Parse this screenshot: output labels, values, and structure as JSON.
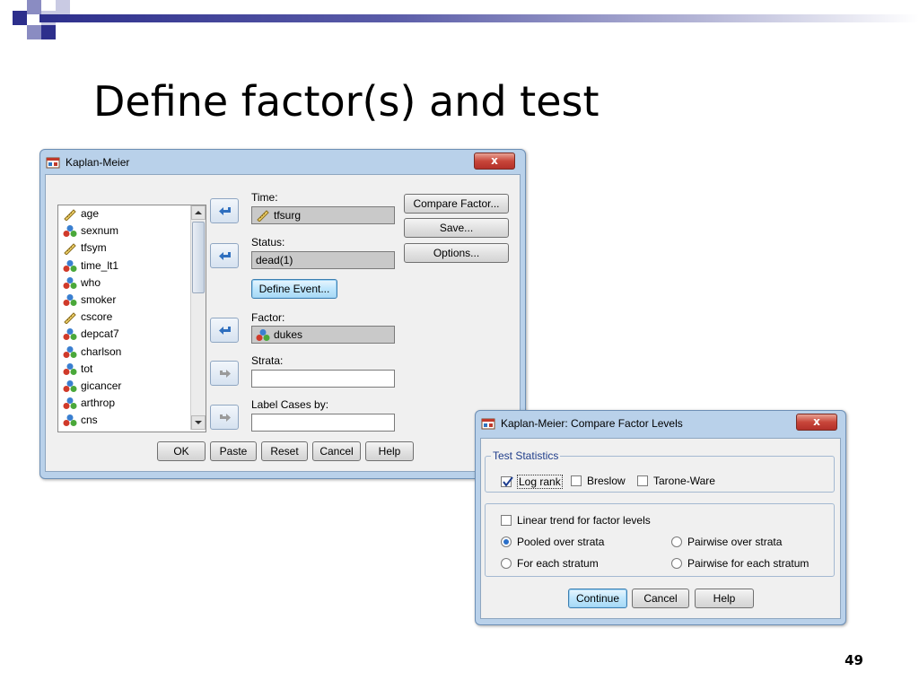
{
  "slide": {
    "title": "Define factor(s) and test",
    "page_number": "49"
  },
  "km_dialog": {
    "title": "Kaplan-Meier",
    "close_label": "x",
    "variables": [
      {
        "name": "age",
        "icon": "scale-ruler-icon"
      },
      {
        "name": "sexnum",
        "icon": "nominal-balls-icon"
      },
      {
        "name": "tfsym",
        "icon": "scale-ruler-icon"
      },
      {
        "name": "time_lt1",
        "icon": "nominal-balls-icon"
      },
      {
        "name": "who",
        "icon": "nominal-balls-icon"
      },
      {
        "name": "smoker",
        "icon": "nominal-balls-icon"
      },
      {
        "name": "cscore",
        "icon": "scale-ruler-icon"
      },
      {
        "name": "depcat7",
        "icon": "nominal-balls-icon"
      },
      {
        "name": "charlson",
        "icon": "nominal-balls-icon"
      },
      {
        "name": "tot",
        "icon": "nominal-balls-icon"
      },
      {
        "name": "gicancer",
        "icon": "nominal-balls-icon"
      },
      {
        "name": "arthrop",
        "icon": "nominal-balls-icon"
      },
      {
        "name": "cns",
        "icon": "nominal-balls-icon"
      }
    ],
    "time_label": "Time:",
    "time_value": "tfsurg",
    "status_label": "Status:",
    "status_value": "dead(1)",
    "define_event_label": "Define Event...",
    "factor_label": "Factor:",
    "factor_value": "dukes",
    "strata_label": "Strata:",
    "strata_value": "",
    "label_cases_label": "Label Cases by:",
    "label_cases_value": "",
    "compare_factor_label": "Compare Factor...",
    "save_label": "Save...",
    "options_label": "Options...",
    "ok_label": "OK",
    "paste_label": "Paste",
    "reset_label": "Reset",
    "cancel_label": "Cancel",
    "help_label": "Help"
  },
  "compare_dialog": {
    "title": "Kaplan-Meier: Compare Factor Levels",
    "close_label": "x",
    "test_statistics_label": "Test Statistics",
    "log_rank_label": "Log rank",
    "log_rank_checked": true,
    "breslow_label": "Breslow",
    "breslow_checked": false,
    "tarone_ware_label": "Tarone-Ware",
    "tarone_ware_checked": false,
    "linear_trend_label": "Linear trend for factor levels",
    "linear_trend_checked": false,
    "pooled_label": "Pooled over strata",
    "pairwise_label": "Pairwise over strata",
    "for_each_label": "For each stratum",
    "pairwise_each_label": "Pairwise for each stratum",
    "selected_option": "Pooled over strata",
    "continue_label": "Continue",
    "cancel_label": "Cancel",
    "help_label": "Help"
  },
  "colors": {
    "title_bar": "#b9d1ea",
    "client_bg": "#f0f0f0",
    "close_button": "#c8463a",
    "slide_bar": "#2d2f8c"
  }
}
